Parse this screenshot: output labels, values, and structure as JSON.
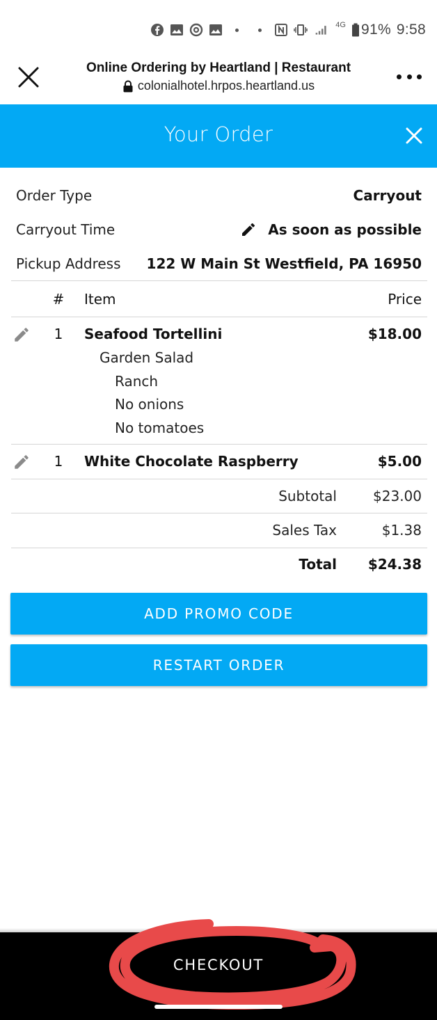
{
  "status_bar": {
    "network": "4G",
    "battery": "91%",
    "time": "9:58",
    "icons": [
      "facebook-icon",
      "gallery-icon",
      "threads-icon",
      "gallery-icon",
      "nfc-icon",
      "vibrate-icon",
      "signal-icon",
      "battery-icon"
    ]
  },
  "browser": {
    "title": "Online Ordering by Heartland | Restaurant",
    "url": "colonialhotel.hrpos.heartland.us"
  },
  "order": {
    "header_title": "Your Order",
    "order_type_label": "Order Type",
    "order_type_value": "Carryout",
    "carryout_time_label": "Carryout Time",
    "carryout_time_value": "As soon as possible",
    "pickup_address_label": "Pickup Address",
    "pickup_address_value": "122 W Main St Westfield, PA 16950"
  },
  "table": {
    "col_num": "#",
    "col_item": "Item",
    "col_price": "Price",
    "items": [
      {
        "qty": "1",
        "name": "Seafood Tortellini",
        "price": "$18.00",
        "side": "Garden Salad",
        "modifiers": [
          "Ranch",
          "No onions",
          "No tomatoes"
        ]
      },
      {
        "qty": "1",
        "name": "White Chocolate Raspberry",
        "price": "$5.00"
      }
    ]
  },
  "totals": {
    "subtotal_label": "Subtotal",
    "subtotal_value": "$23.00",
    "tax_label": "Sales Tax",
    "tax_value": "$1.38",
    "total_label": "Total",
    "total_value": "$24.38"
  },
  "buttons": {
    "promo": "ADD PROMO CODE",
    "restart": "RESTART ORDER",
    "checkout": "CHECKOUT"
  },
  "colors": {
    "accent": "#03a9f4",
    "footer": "#000000",
    "annotation": "#e84a4a"
  }
}
